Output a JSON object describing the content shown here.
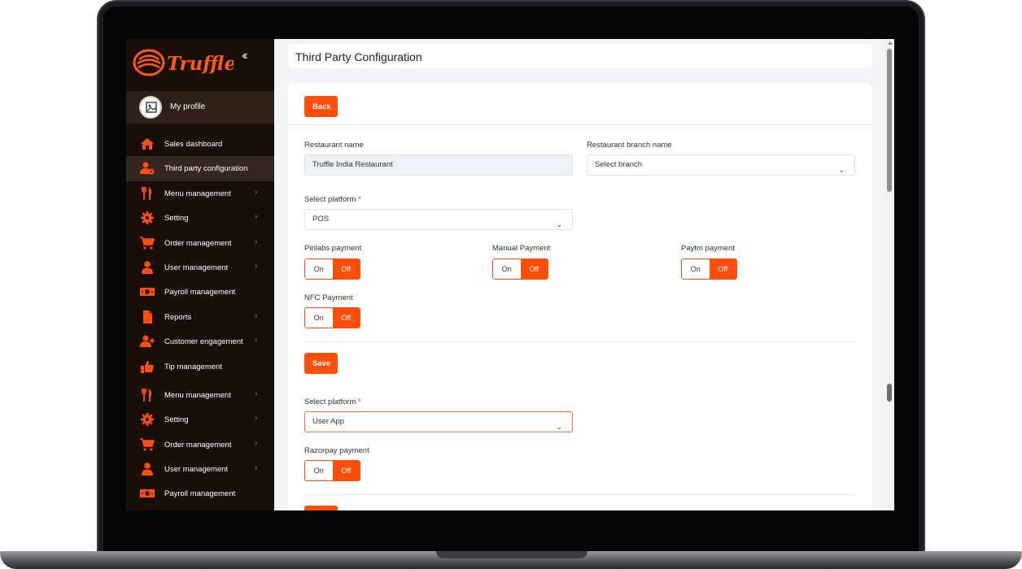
{
  "app": {
    "brand": "Truffle",
    "colors": {
      "accent": "#ff4e0a",
      "sidebar_bg": "#1a0e08"
    }
  },
  "sidebar": {
    "collapse_icon": "double-chevron-left-icon",
    "profile": {
      "label": "My profile",
      "icon": "image-placeholder-icon"
    },
    "items": [
      {
        "label": "Sales dashboard",
        "icon": "home-icon",
        "has_submenu": false
      },
      {
        "label": "Third party configuration",
        "icon": "user-gear-icon",
        "has_submenu": false,
        "active": true
      },
      {
        "label": "Menu management",
        "icon": "fork-knife-icon",
        "has_submenu": true
      },
      {
        "label": "Setting",
        "icon": "gear-icon",
        "has_submenu": true
      },
      {
        "label": "Order management",
        "icon": "cart-icon",
        "has_submenu": true
      },
      {
        "label": "User management",
        "icon": "user-icon",
        "has_submenu": true
      },
      {
        "label": "Payroll management",
        "icon": "money-icon",
        "has_submenu": false
      },
      {
        "label": "Reports",
        "icon": "document-icon",
        "has_submenu": true
      },
      {
        "label": "Customer engagement",
        "icon": "user-plus-icon",
        "has_submenu": true
      },
      {
        "label": "Tip management",
        "icon": "thumbs-up-icon",
        "has_submenu": false
      },
      {
        "label": "Menu management",
        "icon": "fork-knife-icon",
        "has_submenu": true
      },
      {
        "label": "Setting",
        "icon": "gear-icon",
        "has_submenu": true
      },
      {
        "label": "Order management",
        "icon": "cart-icon",
        "has_submenu": true
      },
      {
        "label": "User management",
        "icon": "user-icon",
        "has_submenu": true
      },
      {
        "label": "Payroll management",
        "icon": "money-icon",
        "has_submenu": false
      }
    ]
  },
  "page": {
    "title": "Third Party Configuration",
    "back_label": "Back",
    "restaurant_name": {
      "label": "Restaurant name",
      "value": "Truffle India Restaurant"
    },
    "branch": {
      "label": "Restaurant branch name",
      "value": "Select branch"
    },
    "section1": {
      "platform_label": "Select platform",
      "required_mark": "*",
      "platform_value": "POS",
      "payments": [
        {
          "label": "Pinlabs payment",
          "on": "On",
          "off": "Off",
          "state": "off"
        },
        {
          "label": "Manual Payment",
          "on": "On",
          "off": "Off",
          "state": "off"
        },
        {
          "label": "Paytm payment",
          "on": "On",
          "off": "Off",
          "state": "off"
        },
        {
          "label": "NFC Payment",
          "on": "On",
          "off": "Off",
          "state": "off"
        }
      ],
      "save_label": "Save"
    },
    "section2": {
      "platform_label": "Select platform",
      "required_mark": "*",
      "platform_value": "User App",
      "payments": [
        {
          "label": "Razorpay payment",
          "on": "On",
          "off": "Off",
          "state": "off"
        }
      ]
    }
  }
}
